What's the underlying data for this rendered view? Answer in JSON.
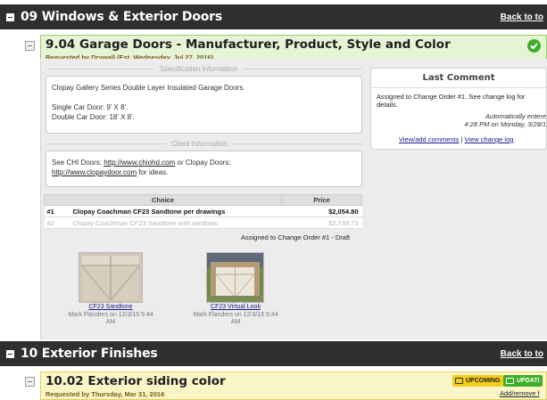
{
  "sections": [
    {
      "title": "09 Windows & Exterior Doors",
      "back_label": "Back to to"
    },
    {
      "title": "10 Exterior Finishes",
      "back_label": "Back to to"
    }
  ],
  "item_904": {
    "title": "9.04 Garage Doors - Manufacturer, Product, Style and Color",
    "requested": "Requested by Drywall (Est. Wednesday, Jul 27, 2016)",
    "status": "complete"
  },
  "spec": {
    "label": "Specification Information",
    "line1": "Clopay Gallery Series Double Layer Insulated Garage Doors.",
    "line2": "Single Car Door: 9' X 8'.",
    "line3": "Double Car Door: 18' X 8'."
  },
  "client": {
    "label": "Client Information",
    "prefix": "See CHI Doors: ",
    "link1": "http://www.chiohd.com",
    "middle": " or Clopay Doors:",
    "link2": "http://www.clopaydoor.com",
    "suffix": " for ideas."
  },
  "comment": {
    "header": "Last Comment",
    "text": "Assigned to Change Order #1. See change log for details.",
    "meta_line1": "Automatically entere",
    "meta_line2": "4:28 PM on Monday, 3/28/1",
    "link_add": "View/add comments",
    "sep": " | ",
    "link_log": "View change log"
  },
  "choices": {
    "headers": [
      "Choice",
      "Price"
    ],
    "rows": [
      {
        "num": "#1",
        "name": "Clopay Coachman CF23 Sandtone per drawings",
        "price": "$2,054.80"
      },
      {
        "num": "#2",
        "name": "Clopay Coachman CF23 Sandtone with windows",
        "price": "$2,739.73"
      }
    ],
    "assigned_note": "Assigned to Change Order #1 - Draft"
  },
  "attachments": [
    {
      "name": "CF23 Sandtone",
      "by": "Mark Flanders on 12/3/15 5:44",
      "time": "AM"
    },
    {
      "name": "CF23 Virtual Look",
      "by": "Mark Flanders on 12/3/15 5:44",
      "time": "AM"
    }
  ],
  "item_1002": {
    "title": "10.02 Exterior siding color",
    "requested": "Requested by Thursday, Mar 31, 2016",
    "badge_upcoming": "UPCOMING",
    "badge_update": "UPDATI",
    "add_remove": "Add/remove f"
  },
  "colors": {
    "section_bar": "#2f2f2f",
    "complete_header": "#e6f4d6",
    "upcoming_header": "#fbf6c8",
    "badge_upcoming": "#f3cc1c",
    "badge_update": "#3fae2a"
  }
}
